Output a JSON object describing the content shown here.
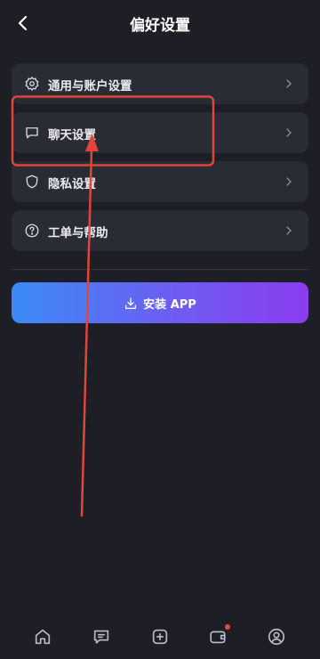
{
  "header": {
    "title": "偏好设置"
  },
  "menu": [
    {
      "label": "通用与账户设置",
      "icon": "gear-icon"
    },
    {
      "label": "聊天设置",
      "icon": "chat-bubble-icon"
    },
    {
      "label": "隐私设置",
      "icon": "shield-icon"
    },
    {
      "label": "工单与帮助",
      "icon": "help-circle-icon"
    }
  ],
  "install": {
    "label": "安装 APP",
    "icon": "download-icon"
  },
  "colors": {
    "background": "#1e1f26",
    "card": "#2a2c35",
    "annotation": "#e0453a",
    "gradient_start": "#3b8bf5",
    "gradient_end": "#8b3df0",
    "badge": "#e5484d"
  },
  "bottom_nav": [
    {
      "icon": "home-icon"
    },
    {
      "icon": "message-icon"
    },
    {
      "icon": "plus-square-icon"
    },
    {
      "icon": "wallet-icon",
      "badge": true
    },
    {
      "icon": "profile-icon"
    }
  ]
}
